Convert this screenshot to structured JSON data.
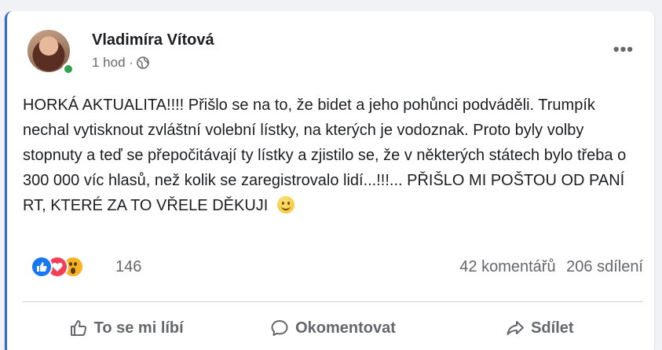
{
  "post": {
    "author": "Vladimíra Vítová",
    "time": "1 hod ·",
    "text": "HORKÁ AKTUALITA!!!! Přišlo se na to, že bidet a jeho pohůnci podváděli. Trumpík nechal vytisknout zvláštní volební lístky, na kterých je vodoznak. Proto byly volby stopnuty a teď se přepočitávají ty lístky a zjistilo se, že v některých státech bylo třeba o 300 000 víc hlasů, než kolik se zaregistrovalo lidí...!!!... PŘIŠLO MI POŠTOU OD PANÍ RT, KTERÉ ZA TO VŘELE DĚKUJI",
    "more_label": "•••"
  },
  "stats": {
    "reaction_count": "146",
    "comments": "42 komentářů",
    "shares": "206 sdílení"
  },
  "actions": {
    "like": "To se mi líbí",
    "comment": "Okomentovat",
    "share": "Sdílet"
  },
  "colors": {
    "accent": "#1877f2",
    "online": "#31a24c",
    "love": "#f33e58",
    "wow": "#f7b125",
    "secondary_text": "#65676b"
  },
  "icons": [
    "globe-icon",
    "more-icon",
    "like-reaction-icon",
    "love-reaction-icon",
    "wow-reaction-icon",
    "smile-emoji-icon",
    "thumbs-up-icon",
    "comment-icon",
    "share-icon"
  ]
}
